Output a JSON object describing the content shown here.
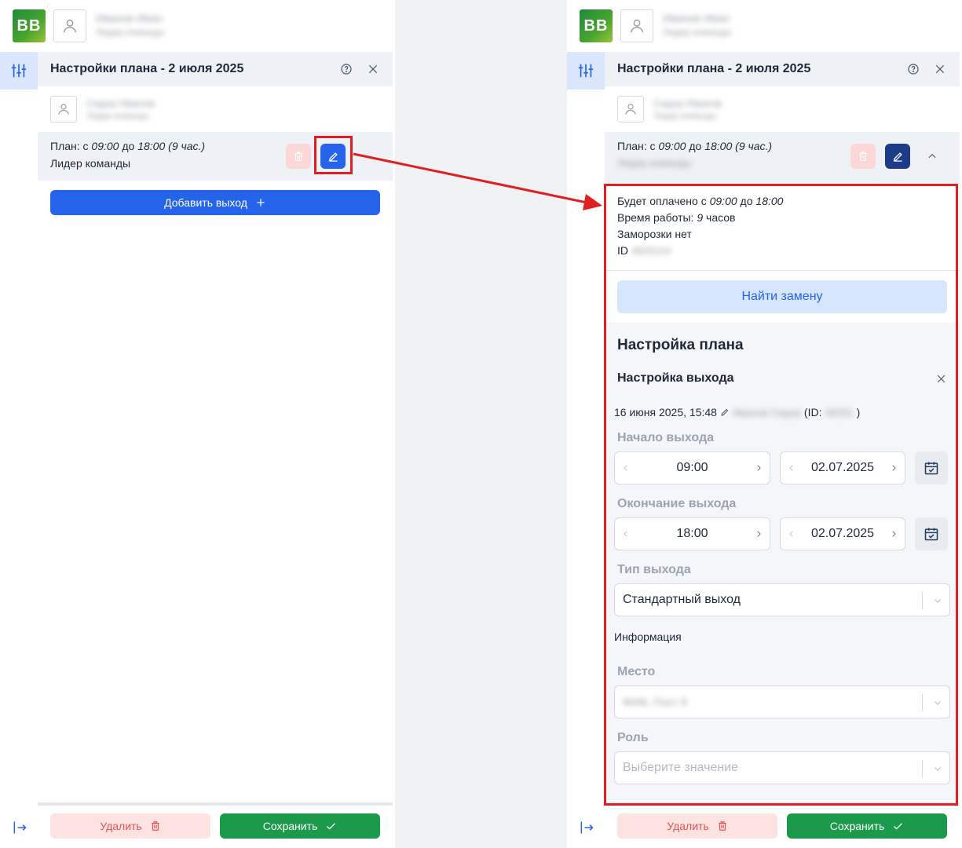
{
  "logo": {
    "text": "BB"
  },
  "left": {
    "header_title": "Настройки плана - 2 июля 2025",
    "plan": {
      "prefix": "План: с",
      "start": "09:00",
      "mid": "до",
      "end": "18:00",
      "duration": "(9 час.)",
      "role": "Лидер команды"
    },
    "add_button": "Добавить выход",
    "delete_button": "Удалить",
    "save_button": "Сохранить"
  },
  "right": {
    "header_title": "Настройки плана - 2 июля 2025",
    "plan": {
      "prefix": "План: с",
      "start": "09:00",
      "mid": "до",
      "end": "18:00",
      "duration": "(9 час.)"
    },
    "details": {
      "paid_prefix": "Будет оплачено с",
      "paid_start": "09:00",
      "paid_mid": "до",
      "paid_end": "18:00",
      "work_prefix": "Время работы:",
      "work_hours": "9",
      "work_suffix": "часов",
      "freeze": "Заморозки нет",
      "id_label": "ID"
    },
    "find_replacement": "Найти замену",
    "settings_title": "Настройка плана",
    "shift_settings_title": "Настройка выхода",
    "meta": {
      "date": "16 июня 2025, 15:48",
      "id_prefix": "(ID:",
      "id_suffix": ")"
    },
    "start_label": "Начало выхода",
    "start_time": "09:00",
    "start_date": "02.07.2025",
    "end_label": "Окончание выхода",
    "end_time": "18:00",
    "end_date": "02.07.2025",
    "type_label": "Тип выхода",
    "type_value": "Стандартный выход",
    "info_label": "Информация",
    "place_label": "Место",
    "role_label": "Роль",
    "role_placeholder": "Выберите значение",
    "delete_button": "Удалить",
    "save_button": "Сохранить"
  },
  "colors": {
    "accent": "#2563eb",
    "accent_dark": "#1e3a8a",
    "danger": "#e25555",
    "success": "#1a9a4a",
    "annotation": "#e02020"
  },
  "icons": [
    "user-icon",
    "sliders-icon",
    "help-icon",
    "close-icon",
    "trash-icon",
    "pencil-icon",
    "plus-icon",
    "check-icon",
    "logout-icon",
    "chevron-up-icon",
    "chevron-left-icon",
    "chevron-right-icon",
    "calendar-icon",
    "chevron-down-icon"
  ]
}
